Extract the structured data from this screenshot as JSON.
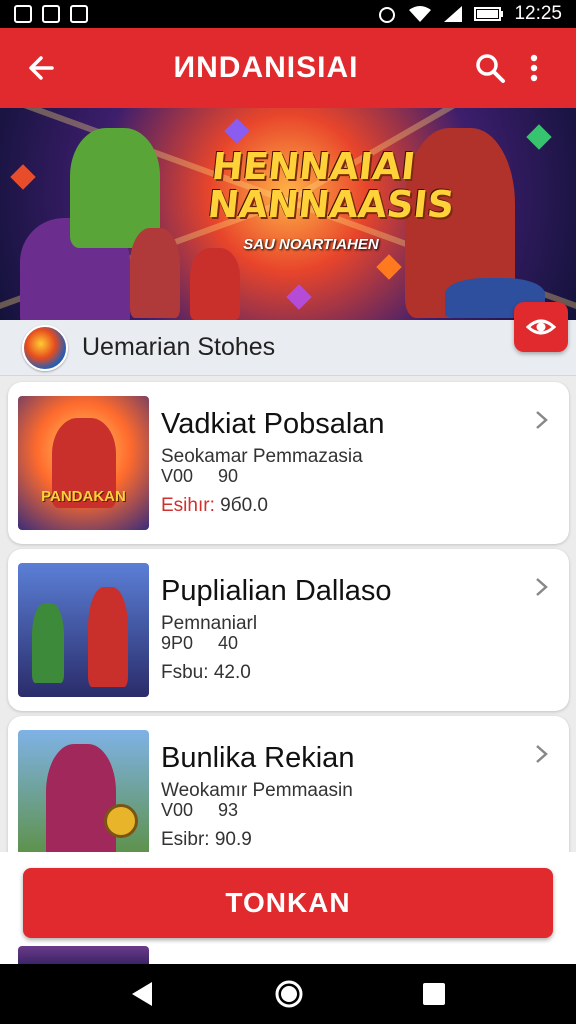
{
  "status_bar": {
    "time": "12:25"
  },
  "app_bar": {
    "title": "ИNDANISIAI",
    "back_icon": "arrow-left-icon",
    "search_icon": "search-icon",
    "menu_icon": "more-vert-icon"
  },
  "banner": {
    "headline_line1": "HENNAIAI",
    "headline_line2": "NANNAASIS",
    "subtitle": "SAU NOARTIAHEN"
  },
  "section": {
    "label": "Uemarian Stohes"
  },
  "items": [
    {
      "title": "Vadkiat Pobsalan",
      "subtitle": "Seokamar Pemmazasia",
      "meta": "V00     90",
      "price_prefix": "Esihır:",
      "price": "9б0.0",
      "thumb_text": "PANDAKAN"
    },
    {
      "title": "Puplialian Dallaso",
      "subtitle": "Pemnaniarl",
      "meta": "9P0     40",
      "price_prefix": "Fsbu:",
      "price": "42.0",
      "thumb_text": ""
    },
    {
      "title": "Bunlika Rekian",
      "subtitle": "Weokamır Pemmaasin",
      "meta": "V00     93",
      "price_prefix": "Esibr:",
      "price": "90.9",
      "thumb_text": ""
    }
  ],
  "cta": {
    "label": "TONKAN"
  },
  "colors": {
    "primary": "#e02a2e",
    "price_prefix": "#d0312d"
  }
}
